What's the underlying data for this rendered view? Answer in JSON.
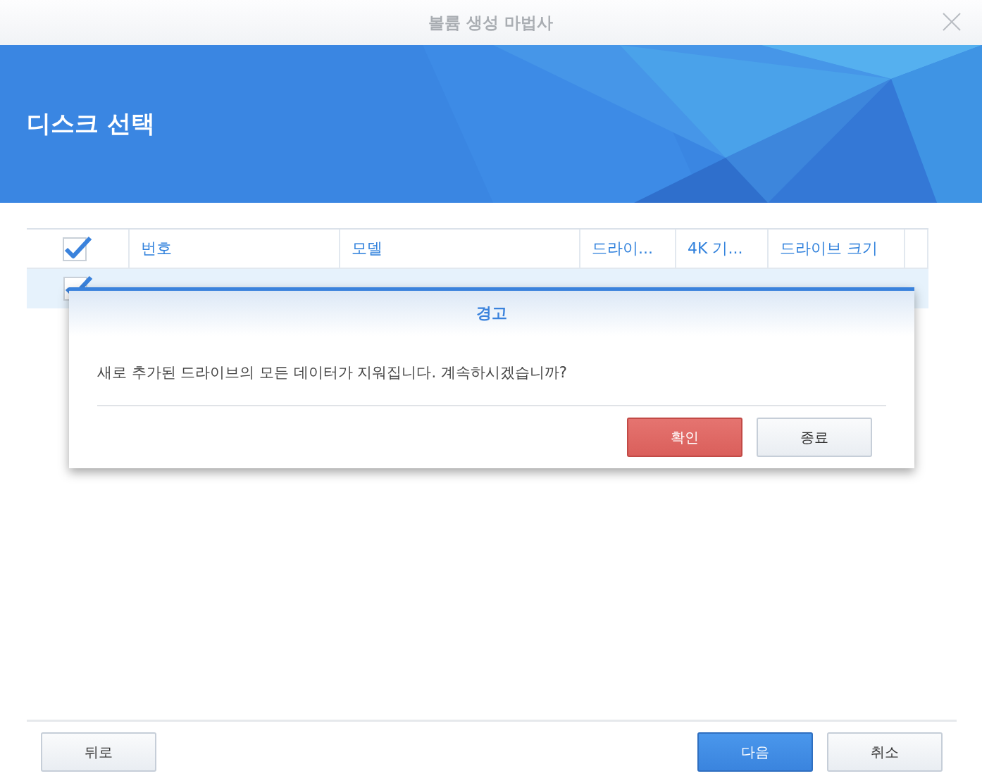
{
  "window": {
    "title": "볼륨 생성 마법사"
  },
  "header": {
    "title": "디스크 선택"
  },
  "table": {
    "select_all_checked": true,
    "columns": [
      "번호",
      "모델",
      "드라이...",
      "4K 기...",
      "드라이브 크기"
    ],
    "rows": [
      {
        "selected": true,
        "checked": true
      }
    ]
  },
  "dialog": {
    "title": "경고",
    "message": "새로 추가된 드라이브의 모든 데이터가 지워집니다. 계속하시겠습니까?",
    "buttons": [
      {
        "label": "확인",
        "kind": "danger"
      },
      {
        "label": "종료",
        "kind": "default"
      }
    ]
  },
  "footer": {
    "buttons": [
      {
        "label": "뒤로",
        "kind": "back"
      },
      {
        "label": "다음",
        "kind": "primary"
      },
      {
        "label": "취소",
        "kind": "cancel"
      }
    ]
  }
}
